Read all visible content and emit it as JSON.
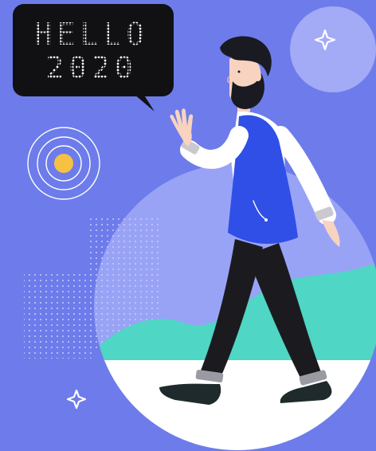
{
  "speech_bubble": {
    "line1": "HELLO",
    "line2": "2020"
  },
  "colors": {
    "background": "#6d7cea",
    "large_circle": "#99a3f6",
    "ground": "#ffffff",
    "hills": "#4fd6c4",
    "bubble": "#111114",
    "vest": "#2f4fe6",
    "shirt": "#ffffff",
    "pants": "#1b1b1f",
    "shoes": "#1f2a2c",
    "hair_beard": "#1a1a22",
    "skin": "#f7d3c0",
    "sun_dot": "#f6c142",
    "sparkle": "#ffffff"
  },
  "icons": [
    "sparkle-icon",
    "target-rings-icon"
  ]
}
